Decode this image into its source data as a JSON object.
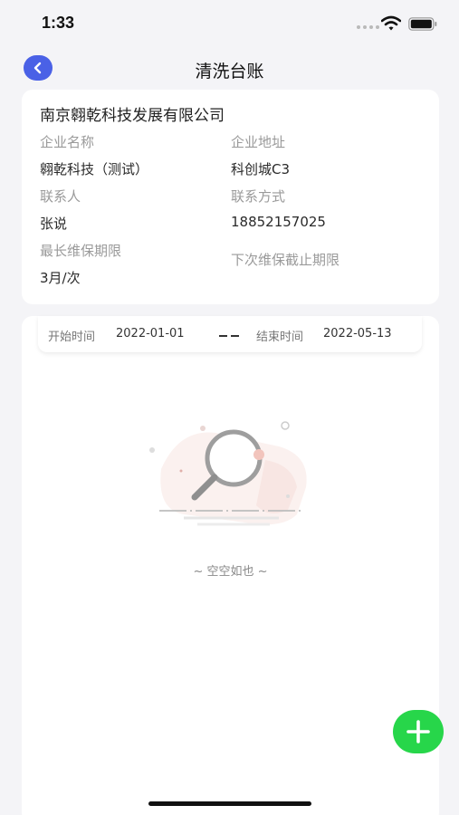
{
  "status_bar": {
    "time": "1:33"
  },
  "nav": {
    "title": "清洗台账",
    "back_icon": "chevron-left-icon",
    "accent_color": "#4a61e6"
  },
  "company": {
    "name": "南京翱乾科技发展有限公司",
    "fields": {
      "enterprise_name_label": "企业名称",
      "enterprise_name_value": "翱乾科技（测试）",
      "enterprise_address_label": "企业地址",
      "enterprise_address_value": "科创城C3",
      "contact_label": "联系人",
      "contact_value": "张说",
      "contact_method_label": "联系方式",
      "contact_method_value": "18852157025",
      "max_maintenance_label": "最长维保期限",
      "max_maintenance_value": "3月/次",
      "next_deadline_label": "下次维保截止期限",
      "next_deadline_value": ""
    }
  },
  "date_range": {
    "start_label": "开始时间",
    "start_value": "2022-01-01",
    "end_label": "结束时间",
    "end_value": "2022-05-13"
  },
  "empty_state": {
    "icon": "magnifier-empty-icon",
    "text": "~ 空空如也 ~"
  },
  "add_button": {
    "icon": "plus-icon",
    "color": "#27d64a"
  }
}
